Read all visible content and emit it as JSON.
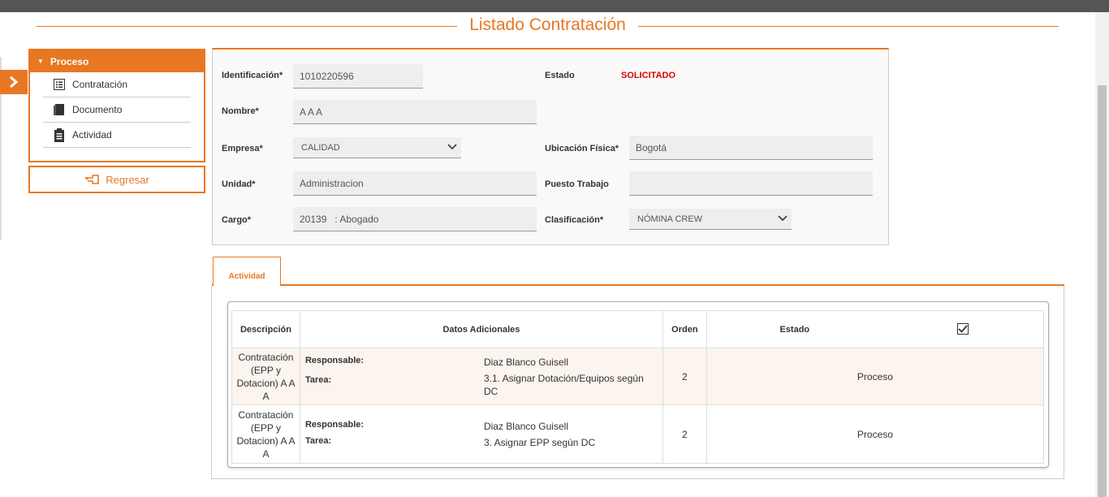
{
  "page": {
    "title": "Listado Contratación"
  },
  "sidebar": {
    "header": "Proceso",
    "items": [
      {
        "label": "Contratación",
        "icon": "list-icon"
      },
      {
        "label": "Documento",
        "icon": "book-icon"
      },
      {
        "label": "Actividad",
        "icon": "clipboard-icon"
      }
    ],
    "back_button": "Regresar"
  },
  "form": {
    "identificacion": {
      "label": "Identificación*",
      "value": "1010220596"
    },
    "estado": {
      "label": "Estado",
      "value": "SOLICITADO"
    },
    "nombre": {
      "label": "Nombre*",
      "value": "A A A"
    },
    "empresa": {
      "label": "Empresa*",
      "value": "CALIDAD"
    },
    "ubicacion": {
      "label": "Ubicación Física*",
      "value": "Bogotá"
    },
    "unidad": {
      "label": "Unidad*",
      "value": "Administracion"
    },
    "puesto": {
      "label": "Puesto Trabajo",
      "value": ""
    },
    "cargo": {
      "label": "Cargo*",
      "value": "20139   : Abogado"
    },
    "clasificacion": {
      "label": "Clasificación*",
      "value": "NÓMINA CREW"
    }
  },
  "tabs": [
    {
      "label": "Actividad"
    }
  ],
  "table": {
    "headers": {
      "descripcion": "Descripción",
      "datos": "Datos Adicionales",
      "orden": "Orden",
      "estado": "Estado"
    },
    "rows": [
      {
        "descripcion": "Contratación (EPP y Dotacion) A A A",
        "responsable_label": "Responsable:",
        "responsable": "Diaz Blanco Guisell",
        "tarea_label": "Tarea:",
        "tarea": "3.1. Asignar Dotación/Equipos según DC",
        "orden": "2",
        "estado": "Proceso"
      },
      {
        "descripcion": "Contratación (EPP y Dotacion) A A A",
        "responsable_label": "Responsable:",
        "responsable": "Diaz Blanco Guisell",
        "tarea_label": "Tarea:",
        "tarea": "3. Asignar EPP según DC",
        "orden": "2",
        "estado": "Proceso"
      }
    ]
  },
  "colors": {
    "accent": "#e87722",
    "estado": "#dd0000"
  }
}
